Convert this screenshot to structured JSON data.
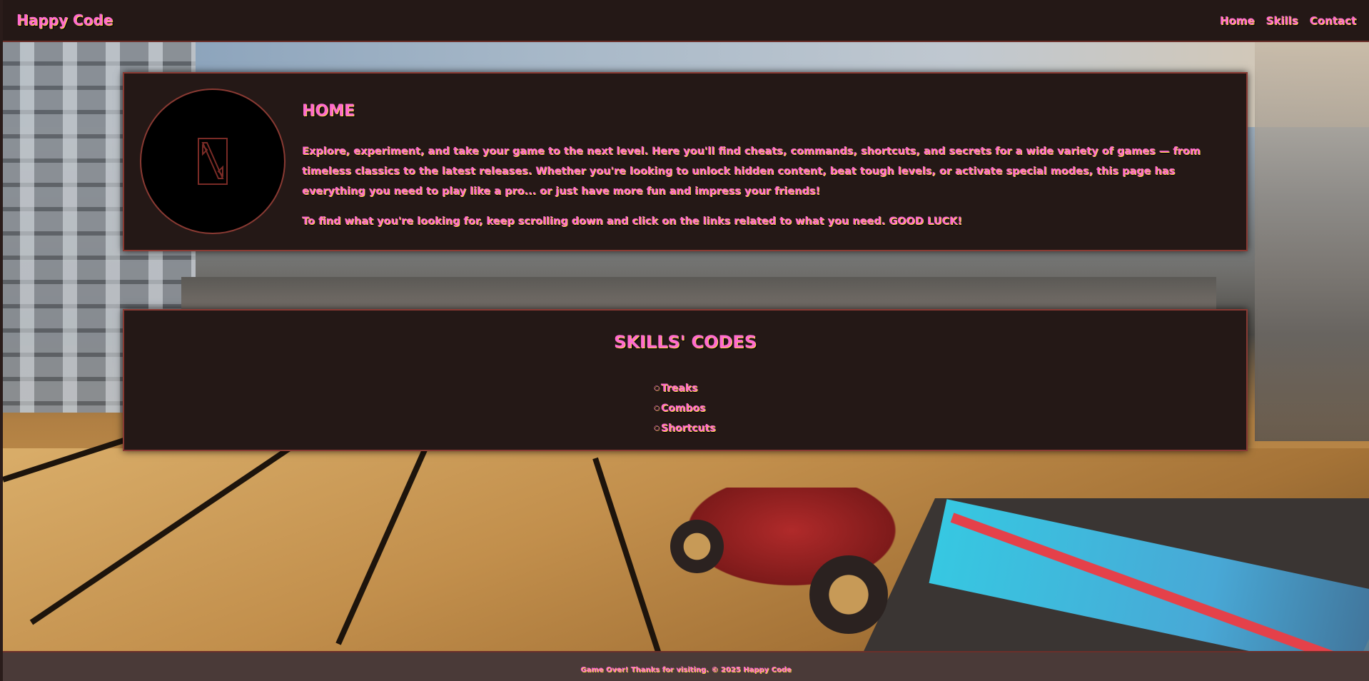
{
  "header": {
    "brand": "Happy Code",
    "nav": [
      "Home",
      "Skills",
      "Contact"
    ]
  },
  "home": {
    "title": "HOME",
    "paragraph1": "Explore, experiment, and take your game to the next level. Here you'll find cheats, commands, shortcuts, and secrets for a wide variety of games — from timeless classics to the latest releases. Whether you're looking to unlock hidden content, beat tough levels, or activate special modes, this page has everything you need to play like a pro... or just have more fun and impress your friends!",
    "paragraph2": "To find what you're looking for, keep scrolling down and click on the links related to what you need. GOOD LUCK!",
    "logo_icon": "dota-logo-icon"
  },
  "skills": {
    "title": "SKILLS' CODES",
    "items": [
      "Treaks",
      "Combos",
      "Shortcuts"
    ]
  },
  "footer": {
    "text": "Game Over! Thanks for visiting. © 2025 Happy Code"
  },
  "colors": {
    "text_pink": "#ff6ccf",
    "text_shadow_yellow": "#ffd34a",
    "panel_bg": "#241816",
    "border": "#8a3a33",
    "footer_bg": "#4a3a38"
  }
}
